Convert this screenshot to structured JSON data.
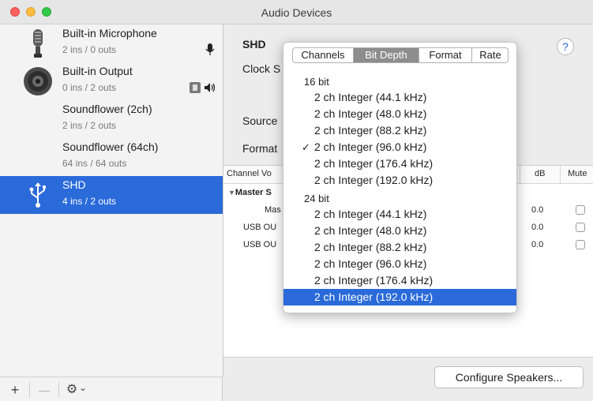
{
  "window": {
    "title": "Audio Devices"
  },
  "devices": [
    {
      "name": "Built-in Microphone",
      "io": "2 ins / 0 outs",
      "icon": "microphone-icon"
    },
    {
      "name": "Built-in Output",
      "io": "0 ins / 2 outs",
      "icon": "speaker-icon"
    },
    {
      "name": "Soundflower (2ch)",
      "io": "2 ins / 2 outs"
    },
    {
      "name": "Soundflower (64ch)",
      "io": "64 ins / 64 outs"
    },
    {
      "name": "SHD",
      "io": "4 ins / 2 outs",
      "icon": "usb-icon",
      "selected": true
    }
  ],
  "toolbar": {
    "add": "+",
    "remove": "—",
    "action": "⚙",
    "chevron": "⌄"
  },
  "detail": {
    "title": "SHD",
    "clock_label": "Clock S",
    "help": "?",
    "source_label": "Source",
    "format_label": "Format"
  },
  "table": {
    "headers": {
      "channel_volume": "Channel Vo",
      "db": "dB",
      "mute": "Mute"
    },
    "group": "Master S",
    "rows": [
      {
        "label": "Mas",
        "db": "0.0"
      },
      {
        "label": "USB OU",
        "db": "0.0"
      },
      {
        "label": "USB OU",
        "db": "0.0"
      }
    ]
  },
  "configure_button": "Configure Speakers...",
  "popup": {
    "tabs": [
      "Channels",
      "Bit Depth",
      "Format",
      "Rate"
    ],
    "active_tab": "Bit Depth",
    "groups": [
      {
        "header": "16 bit",
        "items": [
          {
            "label": "2 ch Integer (44.1 kHz)"
          },
          {
            "label": "2 ch Integer (48.0 kHz)"
          },
          {
            "label": "2 ch Integer (88.2 kHz)"
          },
          {
            "label": "2 ch Integer (96.0 kHz)",
            "checked": true
          },
          {
            "label": "2 ch Integer (176.4 kHz)"
          },
          {
            "label": "2 ch Integer (192.0 kHz)"
          }
        ]
      },
      {
        "header": "24 bit",
        "items": [
          {
            "label": "2 ch Integer (44.1 kHz)"
          },
          {
            "label": "2 ch Integer (48.0 kHz)"
          },
          {
            "label": "2 ch Integer (88.2 kHz)"
          },
          {
            "label": "2 ch Integer (96.0 kHz)"
          },
          {
            "label": "2 ch Integer (176.4 kHz)"
          },
          {
            "label": "2 ch Integer (192.0 kHz)",
            "highlighted": true
          }
        ]
      }
    ],
    "check_mark": "✓"
  },
  "colors": {
    "selection": "#2a6ad9",
    "tab_active": "#8d8d8d"
  }
}
